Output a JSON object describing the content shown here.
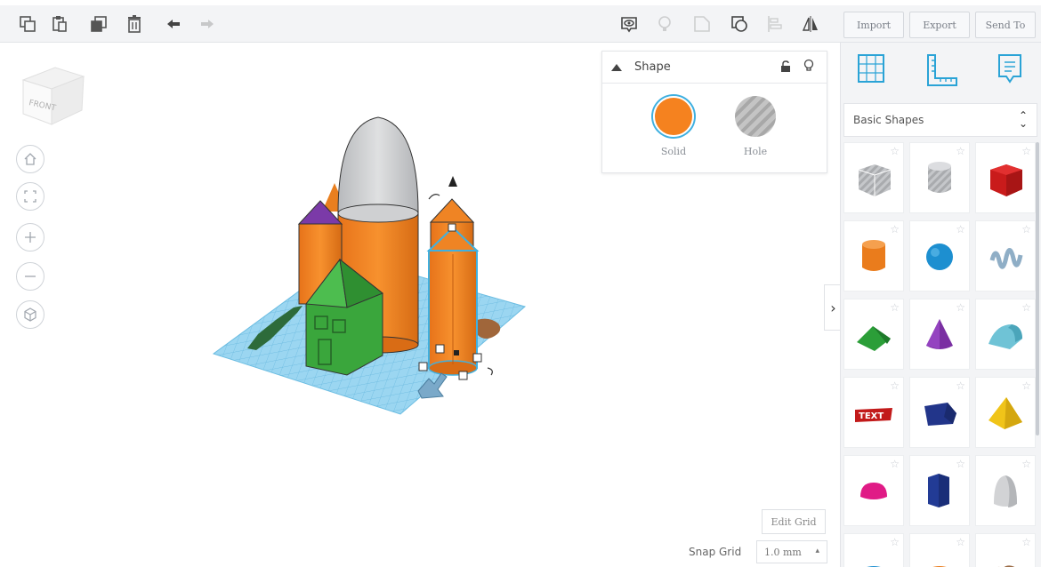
{
  "toolbar": {
    "tools": [
      "copy-icon",
      "paste-icon",
      "duplicate-icon",
      "delete-icon",
      "undo-icon",
      "redo-icon"
    ],
    "view_tools": [
      "show-all-icon",
      "light-bulb-icon",
      "group-icon",
      "ungroup-icon",
      "align-icon",
      "mirror-icon"
    ]
  },
  "actions": {
    "import_label": "Import",
    "export_label": "Export",
    "send_label": "Send To"
  },
  "view_cube": {
    "label": "FRONT"
  },
  "navigation": [
    "home-icon",
    "fit-all-icon",
    "zoom-in-icon",
    "zoom-out-icon",
    "orthographic-icon"
  ],
  "inspector": {
    "title": "Shape",
    "options": [
      {
        "label": "Solid",
        "color": "#f5821f",
        "selected": true
      },
      {
        "label": "Hole",
        "color": "#b8b8b8",
        "selected": false
      }
    ]
  },
  "panel": {
    "icons": [
      "workplane-icon",
      "ruler-icon",
      "notes-icon"
    ],
    "category": "Basic Shapes",
    "shapes": [
      "box-hole",
      "cylinder-hole",
      "box",
      "cylinder",
      "sphere",
      "scribble",
      "roof",
      "cone",
      "round-roof",
      "text",
      "polygon",
      "pyramid",
      "half-sphere",
      "hexagonal-prism",
      "paraboloid"
    ]
  },
  "grid": {
    "edit_label": "Edit Grid",
    "snap_label": "Snap Grid",
    "snap_value": "1.0 mm"
  },
  "colors": {
    "orange": "#f5821f",
    "green": "#3aa63c",
    "purple": "#7b3aa8",
    "grey": "#c9cbcd",
    "workplane": "#8fd0ef",
    "selection": "#3fb0e0"
  }
}
